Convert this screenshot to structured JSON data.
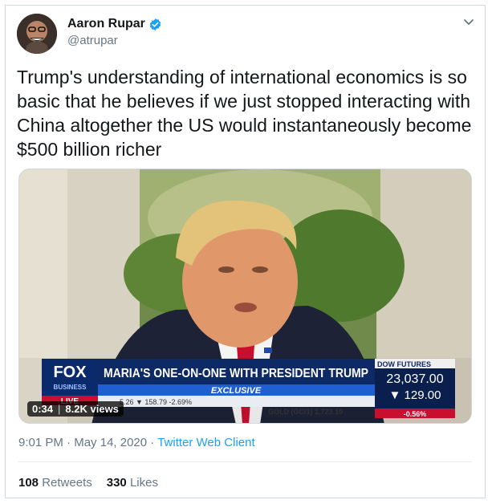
{
  "tweet": {
    "author_name": "Aaron Rupar",
    "author_handle": "@atrupar",
    "text": "Trump's understanding of international economics is so basic that he believes if we just stopped interacting with China altogether the US would instantaneously become $500 billion richer",
    "time": "9:01 PM",
    "date": "May 14, 2020",
    "client": "Twitter Web Client",
    "retweets_count": "108",
    "retweets_label": "Retweets",
    "likes_count": "330",
    "likes_label": "Likes"
  },
  "video": {
    "duration": "0:34",
    "views": "8.2K views",
    "lower_third": {
      "network_logo": "FOX",
      "network_sub": "BUSINESS",
      "live_label": "LIVE",
      "headline": "MARIA'S ONE-ON-ONE WITH PRESIDENT TRUMP",
      "exclusive": "EXCLUSIVE",
      "ticker_left": "5.26 ▼ 158.79 -2.69%",
      "ticker_gold": "GOLD (GC/1) 1,723.10",
      "dow_label": "DOW FUTURES",
      "dow_value": "23,037.00",
      "dow_change": "▼ 129.00",
      "dow_pct": "-0.56%"
    }
  },
  "colors": {
    "link": "#1da1f2",
    "verified": "#1da1f2",
    "muted": "#657786",
    "text": "#14171a"
  },
  "icons": [
    "verified-badge-icon",
    "chevron-down-icon"
  ]
}
